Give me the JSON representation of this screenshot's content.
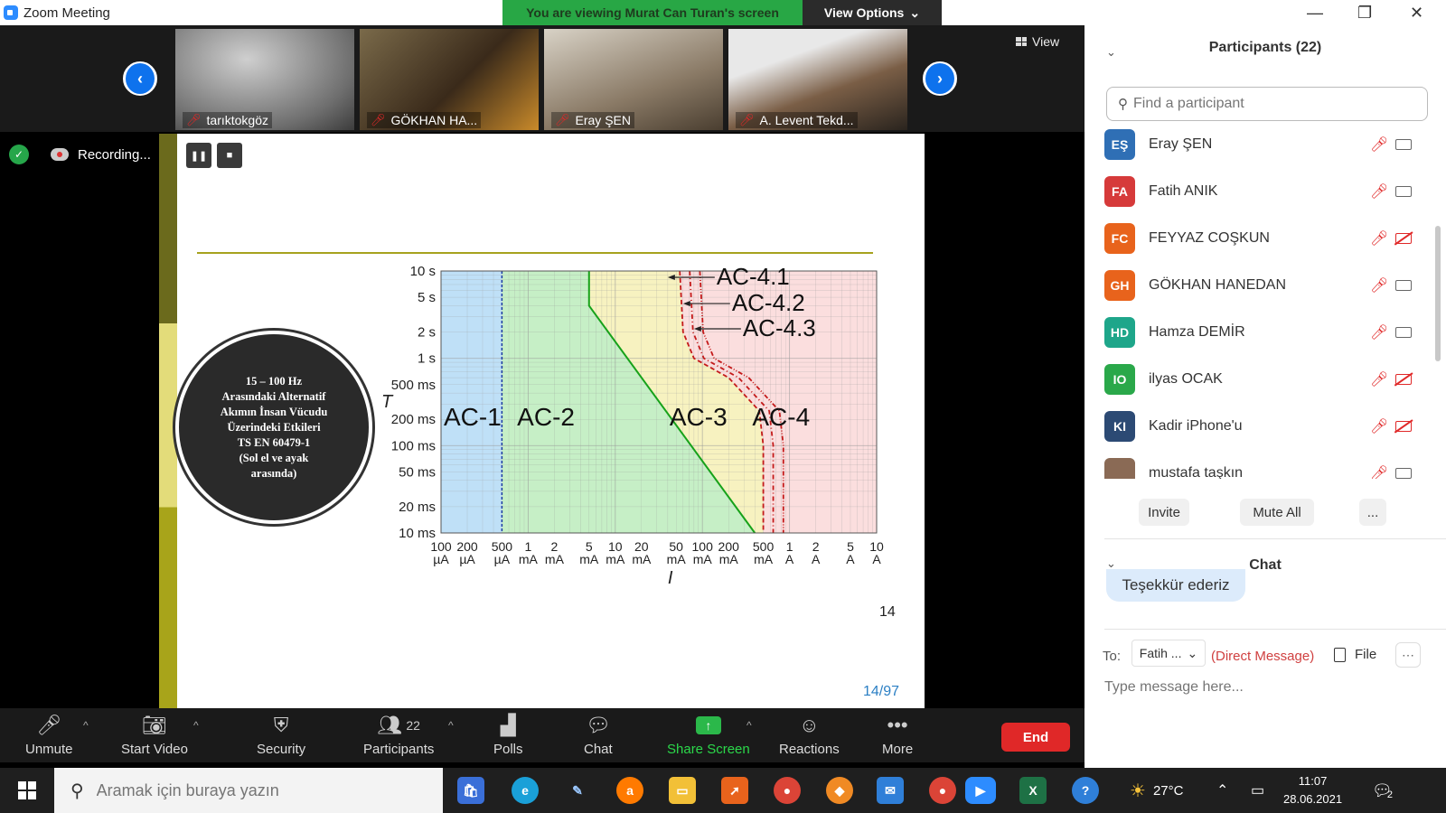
{
  "window": {
    "title": "Zoom Meeting"
  },
  "banner": {
    "text": "You are viewing Murat Can Turan's screen",
    "view_options": "View Options"
  },
  "strip": {
    "tiles": [
      {
        "name": "tarıktokgöz"
      },
      {
        "name": "GÖKHAN HA..."
      },
      {
        "name": "Eray ŞEN"
      },
      {
        "name": "A. Levent Tekd..."
      }
    ],
    "view_label": "View"
  },
  "recording": {
    "label": "Recording..."
  },
  "slide": {
    "circle_lines": [
      "15 – 100 Hz",
      "Arasındaki Alternatif",
      "Akımın İnsan Vücudu",
      "Üzerindeki Etkileri",
      "TS EN 60479-1",
      "(Sol el ve ayak",
      "arasında)"
    ],
    "page_number": "14",
    "page_count": "14/97"
  },
  "chart_data": {
    "type": "area",
    "title": "",
    "xlabel": "I",
    "ylabel": "T",
    "x_scale": "log",
    "y_scale": "log",
    "x_ticks": [
      "100 µA",
      "200 µA",
      "500 µA",
      "1 mA",
      "2 mA",
      "5 mA",
      "10 mA",
      "20 mA",
      "50 mA",
      "100 mA",
      "200 mA",
      "500 mA",
      "1 A",
      "2 A",
      "5 A",
      "10 A"
    ],
    "y_ticks": [
      "10 ms",
      "20 ms",
      "50 ms",
      "100 ms",
      "200 ms",
      "500 ms",
      "1 s",
      "2 s",
      "5 s",
      "10 s"
    ],
    "zones": [
      {
        "name": "AC-1",
        "color": "#bfe0f7"
      },
      {
        "name": "AC-2",
        "color": "#c6efc6"
      },
      {
        "name": "AC-3",
        "color": "#f7f2c0"
      },
      {
        "name": "AC-4",
        "color": "#fbdede"
      }
    ],
    "curve_labels": [
      "AC-4.1",
      "AC-4.2",
      "AC-4.3"
    ]
  },
  "toolbar": {
    "unmute": "Unmute",
    "start_video": "Start Video",
    "security": "Security",
    "participants": "Participants",
    "participants_count": "22",
    "polls": "Polls",
    "chat": "Chat",
    "share_screen": "Share Screen",
    "reactions": "Reactions",
    "more": "More",
    "end": "End"
  },
  "panel": {
    "participants_title": "Participants (22)",
    "search_placeholder": "Find a participant",
    "participants": [
      {
        "initials": "EŞ",
        "name": "Eray ŞEN",
        "color": "#2f6fb5",
        "video_off": false
      },
      {
        "initials": "FA",
        "name": "Fatih ANIK",
        "color": "#d63a3a",
        "video_off": false
      },
      {
        "initials": "FC",
        "name": "FEYYAZ COŞKUN",
        "color": "#e8631c",
        "video_off": true
      },
      {
        "initials": "GH",
        "name": "GÖKHAN HANEDAN",
        "color": "#e8631c",
        "video_off": false
      },
      {
        "initials": "HD",
        "name": "Hamza DEMİR",
        "color": "#1ea68a",
        "video_off": false
      },
      {
        "initials": "IO",
        "name": "ilyas OCAK",
        "color": "#2aa84a",
        "video_off": true
      },
      {
        "initials": "KI",
        "name": "Kadir iPhone'u",
        "color": "#2c4a74",
        "video_off": true
      },
      {
        "initials": "",
        "name": "mustafa taşkın",
        "color": "#8a6a55",
        "video_off": false
      }
    ],
    "invite": "Invite",
    "mute_all": "Mute All",
    "more_dots": "...",
    "chat_title": "Chat",
    "last_message": "Teşekkür ederiz",
    "to_label": "To:",
    "to_value": "Fatih ...",
    "direct_message": "(Direct Message)",
    "file": "File",
    "message_placeholder": "Type message here..."
  },
  "taskbar": {
    "search_placeholder": "Aramak için buraya yazın",
    "weather": "27°C",
    "time": "11:07",
    "date": "28.06.2021",
    "notifications": "2"
  }
}
